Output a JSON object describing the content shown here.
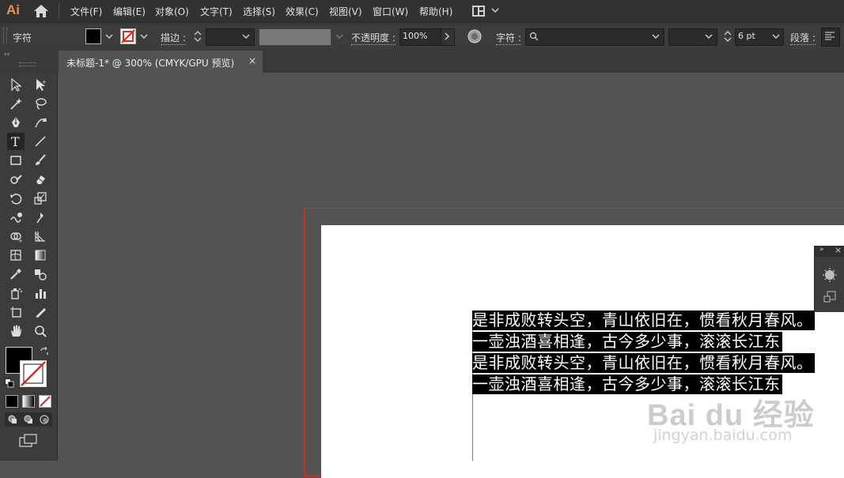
{
  "app": {
    "logo": "Ai"
  },
  "menu": [
    "文件(F)",
    "编辑(E)",
    "对象(O)",
    "文字(T)",
    "选择(S)",
    "效果(C)",
    "视图(V)",
    "窗口(W)",
    "帮助(H)"
  ],
  "control_bar": {
    "mode_label": "字符",
    "stroke_label": "描边 :",
    "opacity_label": "不透明度 :",
    "opacity_value": "100%",
    "char_label": "字符 :",
    "font_size_value": "6 pt",
    "paragraph_label": "段落 :"
  },
  "document_tab": {
    "title": "未标题-1* @ 300% (CMYK/GPU 预览)",
    "close": "×"
  },
  "panel": {
    "collapse": "‹‹",
    "mini_expand": "»",
    "mini_close": "×"
  },
  "artboard_text": [
    "是非成败转头空，青山依旧在，惯看秋月春风。",
    "一壶浊酒喜相逢，古今多少事，滚滚长江东",
    "是非成败转头空，青山依旧在，惯看秋月春风。",
    "一壶浊酒喜相逢，古今多少事，滚滚长江东"
  ],
  "watermark": {
    "brand": "Bai du 经验",
    "url": "jingyan.baidu.com"
  },
  "colors": {
    "app_bg": "#535353",
    "panel_bg": "#3c3c3c",
    "menubar_bg": "#323232",
    "logo": "#e9963e",
    "artboard_bleed": "#c0392b",
    "selection": "#000000"
  },
  "toolbar": {
    "tools": [
      "selection-tool",
      "direct-selection-tool",
      "magic-wand-tool",
      "lasso-tool",
      "pen-tool",
      "curvature-tool",
      "type-tool",
      "line-segment-tool",
      "rectangle-tool",
      "paintbrush-tool",
      "shaper-tool",
      "eraser-tool",
      "rotate-tool",
      "scale-tool",
      "warp-tool",
      "puppet-warp-tool",
      "shape-builder-tool",
      "perspective-grid-tool",
      "mesh-tool",
      "gradient-tool",
      "eyedropper-tool",
      "blend-tool",
      "symbol-sprayer-tool",
      "column-graph-tool",
      "artboard-tool",
      "slice-tool",
      "hand-tool",
      "zoom-tool"
    ],
    "active_tool": "type-tool"
  }
}
